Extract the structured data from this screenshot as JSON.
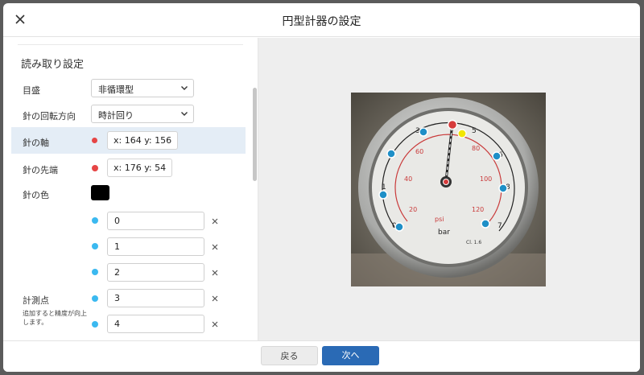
{
  "dialog": {
    "title": "円型計器の設定",
    "close_icon": "close-icon"
  },
  "settings": {
    "section_title": "読み取り設定",
    "scale": {
      "label": "目盛",
      "value": "非循環型"
    },
    "direction": {
      "label": "針の回転方向",
      "value": "時計回り"
    },
    "axis": {
      "label": "針の軸",
      "value": "x: 164 y: 156",
      "color": "#e64545"
    },
    "tip": {
      "label": "針の先端",
      "value": "x: 176 y: 54",
      "color": "#e64545"
    },
    "needle_color": {
      "label": "針の色",
      "value": "#000000"
    },
    "measure_points": {
      "label": "計測点",
      "note": "追加すると精度が向上します。",
      "color": "#3bb9f0",
      "values": [
        "0",
        "1",
        "2",
        "3",
        "4"
      ]
    }
  },
  "footer": {
    "back_label": "戻る",
    "next_label": "次へ"
  },
  "colors": {
    "primary": "#2a6ab5",
    "highlight": "#e4edf6"
  }
}
